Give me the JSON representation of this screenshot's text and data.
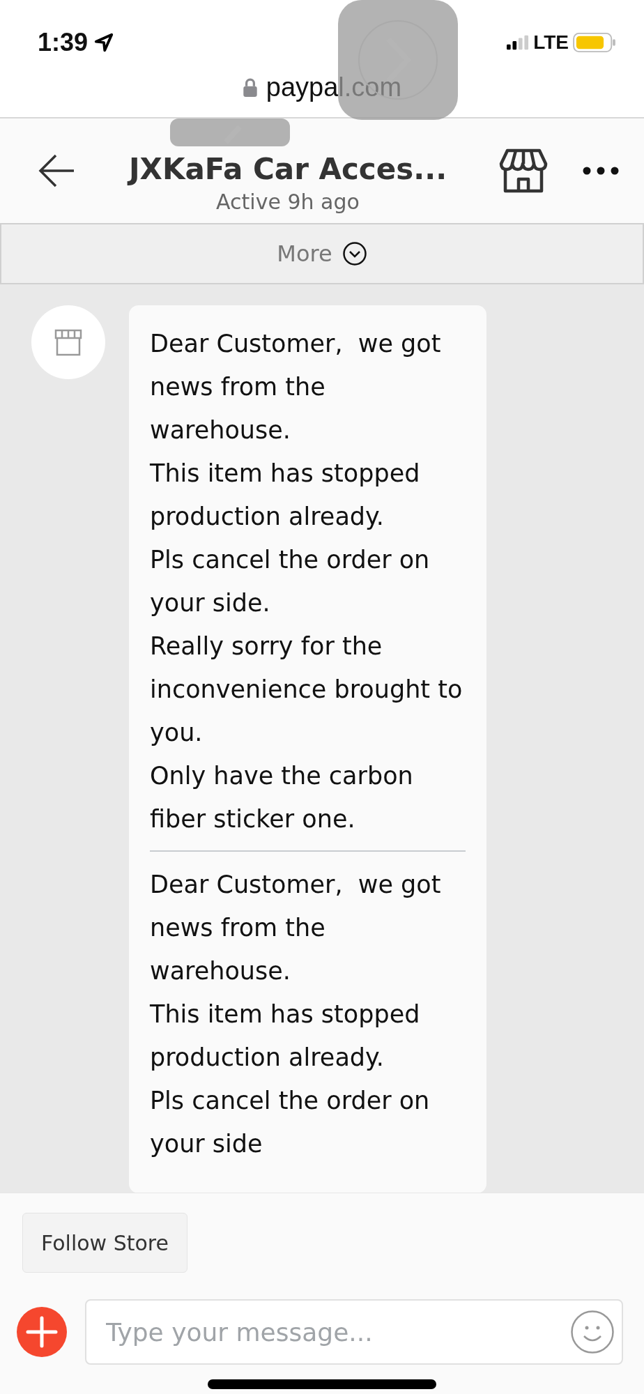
{
  "status_bar": {
    "time": "1:39",
    "network": "LTE"
  },
  "address_bar": {
    "url": "paypal.com"
  },
  "header": {
    "title": "JXKaFa Car Acces...",
    "subtitle": "Active 9h ago"
  },
  "more_bar": {
    "label": "More"
  },
  "messages": [
    {
      "sentences": [
        "Dear Customer,  we got news from the warehouse.",
        "This item has stopped production already.",
        "Pls cancel the order on your side.",
        "Really sorry for the inconvenience brought to you.",
        "Only have the carbon fiber sticker one."
      ]
    },
    {
      "sentences": [
        "Dear Customer,  we got news from the warehouse.",
        "This item has stopped production already.",
        "Pls cancel the order on your side"
      ]
    }
  ],
  "follow_button": {
    "label": "Follow Store"
  },
  "composer": {
    "placeholder": "Type your message..."
  }
}
